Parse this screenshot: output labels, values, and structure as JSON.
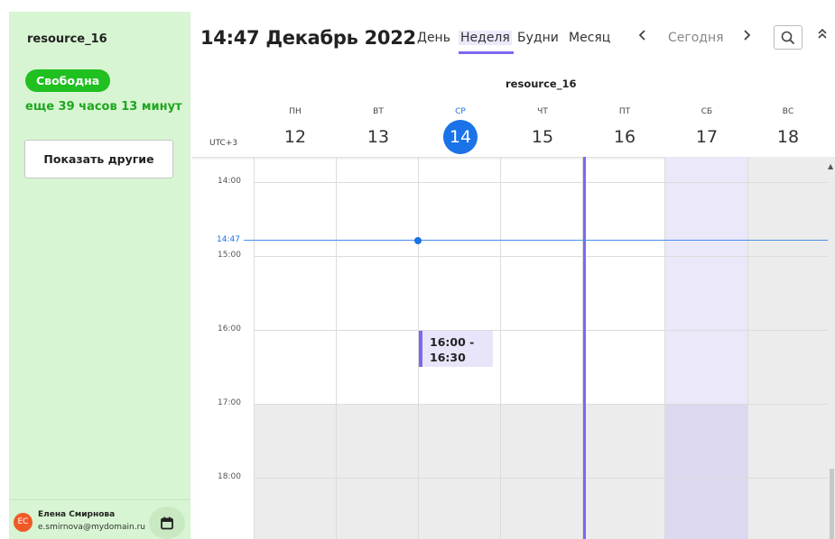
{
  "sidebar": {
    "resource_name": "resource_16",
    "status_label": "Свободна",
    "status_time": "еще 39 часов 13 минут",
    "show_others_label": "Показать другие",
    "colors": {
      "background": "#d7f5d2",
      "status": "#20c020",
      "status_text": "#1fa61f"
    }
  },
  "user": {
    "initials": "ЕС",
    "name": "Елена Смирнова",
    "email": "e.smirnova@mydomain.ru",
    "calendar_icon": "calendar-icon"
  },
  "header": {
    "title": "14:47 Декабрь 2022",
    "views": [
      "День",
      "Неделя",
      "Будни",
      "Месяц"
    ],
    "active_view": "Неделя",
    "prev_icon": "chevron-left-icon",
    "today_label": "Сегодня",
    "next_icon": "chevron-right-icon",
    "search_icon": "search-icon",
    "collapse_icon": "double-chevron-up-icon",
    "accent": "#7b68ee"
  },
  "calendar": {
    "resource_label": "resource_16",
    "timezone": "UTC+3",
    "days": [
      {
        "name": "ПН",
        "num": "12"
      },
      {
        "name": "ВТ",
        "num": "13"
      },
      {
        "name": "СР",
        "num": "14"
      },
      {
        "name": "ЧТ",
        "num": "15"
      },
      {
        "name": "ПТ",
        "num": "16"
      },
      {
        "name": "СБ",
        "num": "17"
      },
      {
        "name": "ВС",
        "num": "18"
      }
    ],
    "today_index": 2,
    "hours": [
      "14:00",
      "15:00",
      "16:00",
      "17:00",
      "18:00"
    ],
    "now_label": "14:47",
    "event": {
      "time": "16:00 - 16:30"
    },
    "colors": {
      "today": "#1a73e8",
      "event_bg": "#e8e5fb",
      "selected_day_bg": "#ece9fb"
    }
  }
}
